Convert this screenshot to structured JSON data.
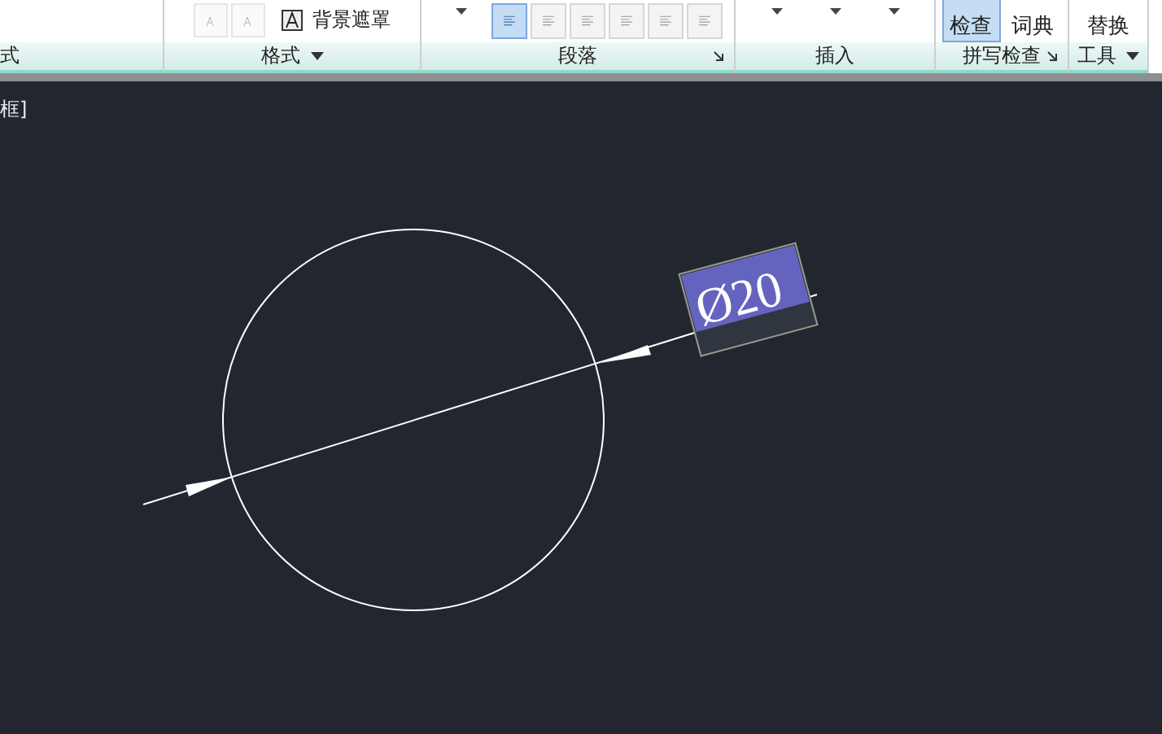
{
  "ribbon": {
    "panels": [
      {
        "label": "式",
        "menu": false,
        "launcher": false
      },
      {
        "label": "格式",
        "menu": true,
        "launcher": false,
        "items": [
          {
            "kind": "icon",
            "disabled": true
          },
          {
            "kind": "icon",
            "disabled": true
          },
          {
            "kind": "check",
            "label": "背景遮罩"
          }
        ]
      },
      {
        "label": "段落",
        "menu": false,
        "launcher": true,
        "items": [
          {
            "kind": "dropdown"
          },
          {
            "kind": "align",
            "selected": true
          },
          {
            "kind": "align",
            "selected": false
          },
          {
            "kind": "align",
            "selected": false
          },
          {
            "kind": "align",
            "selected": false
          },
          {
            "kind": "align",
            "selected": false
          },
          {
            "kind": "align",
            "selected": false
          }
        ]
      },
      {
        "label": "插入",
        "menu": false,
        "launcher": false,
        "items": [
          {
            "kind": "dropdown"
          },
          {
            "kind": "dropdown"
          },
          {
            "kind": "dropdown"
          }
        ]
      },
      {
        "label": "拼写检查",
        "menu": false,
        "launcher": true,
        "items": [
          {
            "kind": "big",
            "label": "检查",
            "selected": true
          },
          {
            "kind": "big",
            "label": "词典",
            "selected": false
          }
        ]
      },
      {
        "label": "工具",
        "menu": true,
        "launcher": false,
        "items": [
          {
            "kind": "big",
            "label": "替换",
            "selected": false
          }
        ]
      }
    ]
  },
  "canvas": {
    "prompt": "框]",
    "dimension": {
      "text": "Ø20"
    }
  }
}
